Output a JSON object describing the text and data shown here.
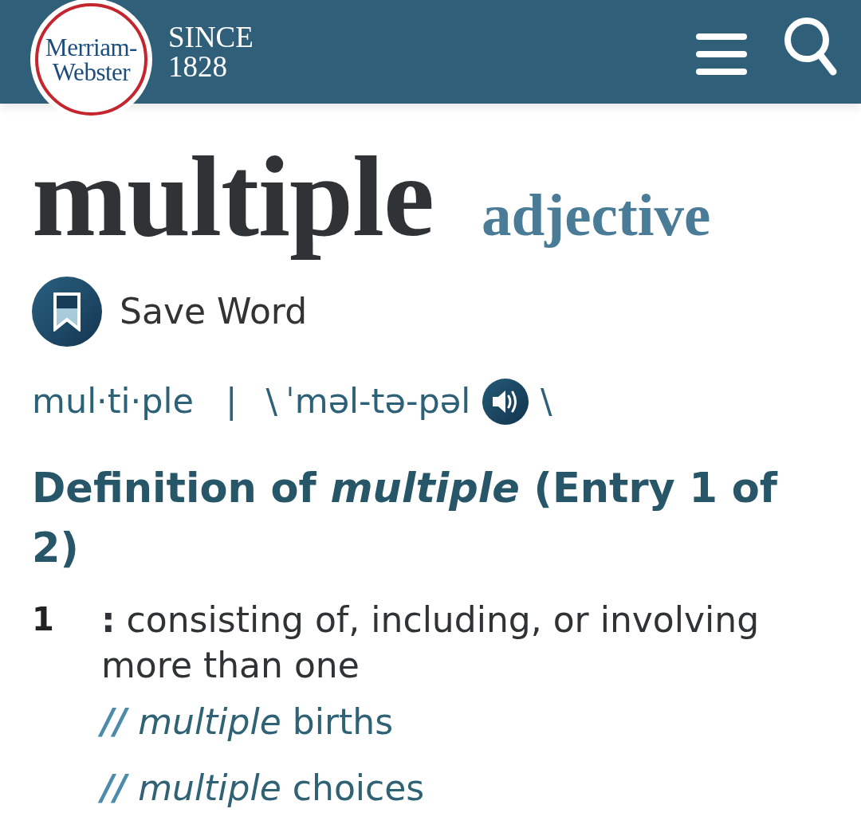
{
  "header": {
    "logo": {
      "line_1": "Merriam-",
      "line_2": "Webster"
    },
    "tagline": {
      "line_1": "SINCE",
      "line_2": "1828"
    }
  },
  "entry": {
    "headword": "multiple",
    "part_of_speech": "adjective"
  },
  "save_word": {
    "label": "Save Word"
  },
  "pronunciation": {
    "syllables": "mul·ti·ple",
    "separator": "|",
    "open_mark": "\\",
    "respelling": "ˈməl-tə-pəl",
    "close_mark": "\\"
  },
  "definition": {
    "heading": "Definition of *multiple* (Entry 1 of 2)",
    "senses": [
      {
        "number": "1",
        "text": "**:** consisting of, including, or involving more than one",
        "examples": [
          {
            "marker": "//",
            "text": "*multiple* births"
          },
          {
            "marker": "//",
            "text": "*multiple* choices"
          }
        ]
      }
    ]
  }
}
